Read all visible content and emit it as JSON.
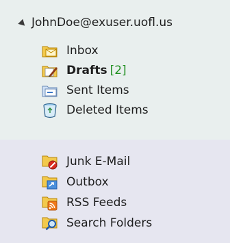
{
  "account": {
    "label": "JohnDoe@exuser.uofl.us",
    "expanded_icon": "expanded-triangle-icon"
  },
  "folders": [
    {
      "label": "Inbox",
      "icon": "inbox-folder-icon"
    },
    {
      "label": "Drafts",
      "count": "[2]",
      "icon": "drafts-folder-icon"
    },
    {
      "label": "Sent Items",
      "icon": "sent-items-folder-icon"
    },
    {
      "label": "Deleted Items",
      "icon": "deleted-items-icon"
    },
    {
      "label": "Junk E-Mail",
      "icon": "junk-email-folder-icon"
    },
    {
      "label": "Outbox",
      "icon": "outbox-folder-icon"
    },
    {
      "label": "RSS Feeds",
      "icon": "rss-feeds-folder-icon"
    },
    {
      "label": "Search Folders",
      "icon": "search-folders-icon"
    }
  ],
  "colors": {
    "upper_band": "#e9efee",
    "lower_band": "#e6e6f0",
    "unread_count": "#1f8f1f"
  }
}
